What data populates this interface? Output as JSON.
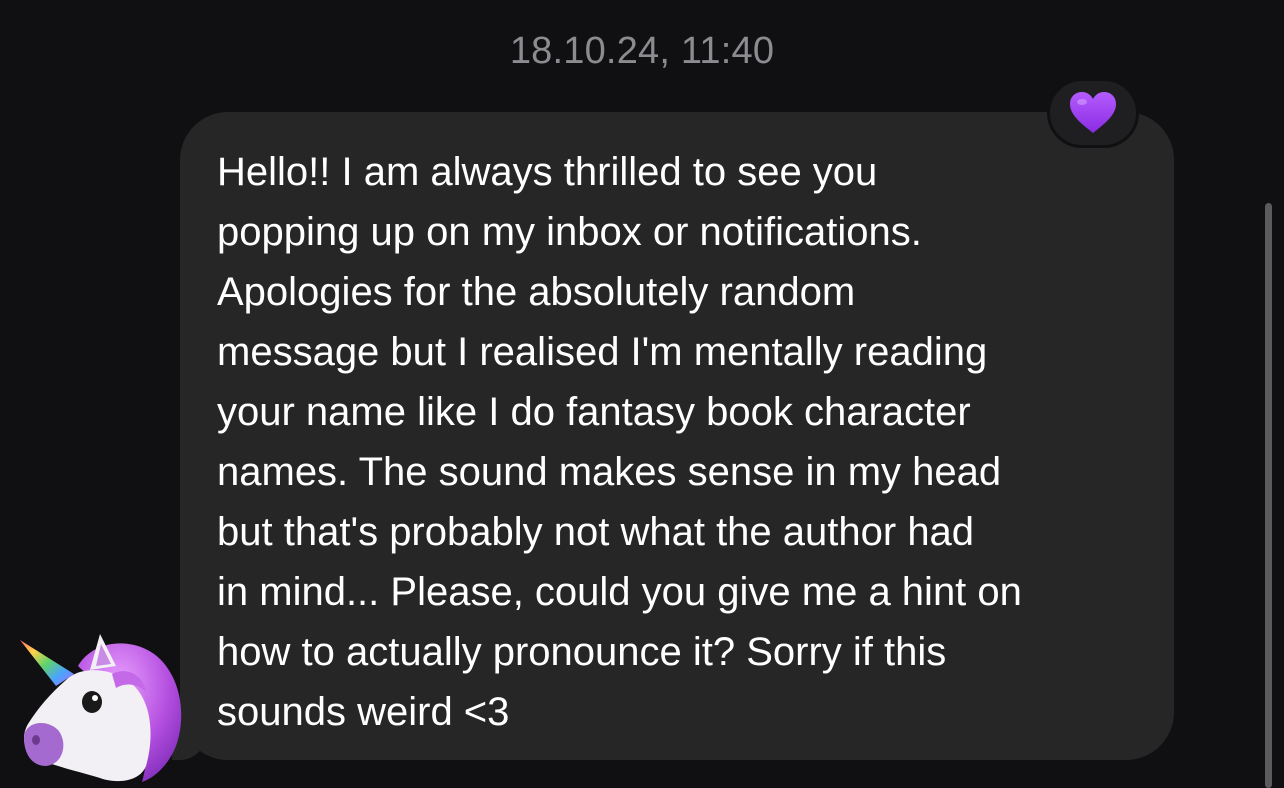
{
  "chat": {
    "timestamp": "18.10.24, 11:40",
    "message": {
      "text": "Hello!! I am always thrilled to see you\npopping up on my inbox or notifications.\nApologies for the absolutely random\nmessage but I realised I'm mentally reading\nyour name like I do fantasy book character\nnames. The sound makes sense in my head\nbut that's probably not what the author had\nin mind... Please, could you give me a hint on\nhow to actually pronounce it? Sorry if this\nsounds weird <3",
      "reaction": "purple-heart-icon",
      "sender_avatar": "unicorn-icon"
    }
  },
  "colors": {
    "background": "#101012",
    "bubble": "#262627",
    "timestamp": "#8c8c90",
    "text": "#ffffff",
    "reaction_heart": "#9b3bf0"
  }
}
